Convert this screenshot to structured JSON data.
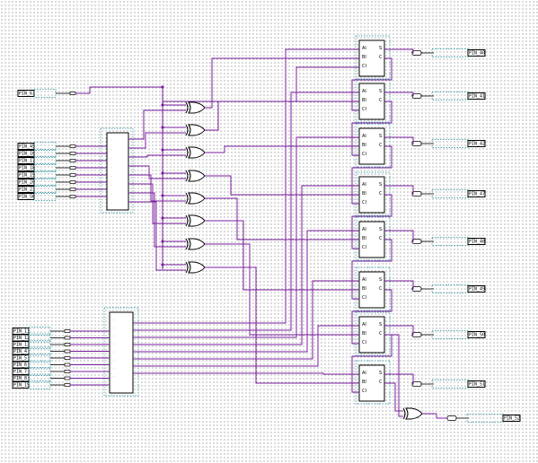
{
  "input_pins_top": [
    "PIN_61"
  ],
  "input_pins_a": [
    "PIN_45",
    "PIN_16",
    "PIN_17",
    "PIN_18",
    "PIN_19",
    "PIN_20",
    "PIN_21",
    "PIN_56"
  ],
  "input_pins_b": [
    "PIN_11",
    "PIN_12",
    "PIN_13",
    "PIN_4",
    "PIN_5",
    "PIN_6",
    "PIN_7",
    "PIN_8",
    "PIN_15"
  ],
  "output_pins": [
    "PIN_40",
    "PIN_41",
    "PIN_42",
    "PIN_47",
    "PIN_48",
    "PIN_49",
    "PIN_50",
    "PIN_51"
  ],
  "carry_pin": "PIN_52",
  "adder_ports": {
    "a": "AI",
    "b": "BI",
    "c": "CI",
    "s": "S",
    "co": "C"
  },
  "colors": {
    "wire": "#7a1e9e",
    "grid": "#6e6e6e",
    "dashed_border": "#1c8f9e"
  }
}
